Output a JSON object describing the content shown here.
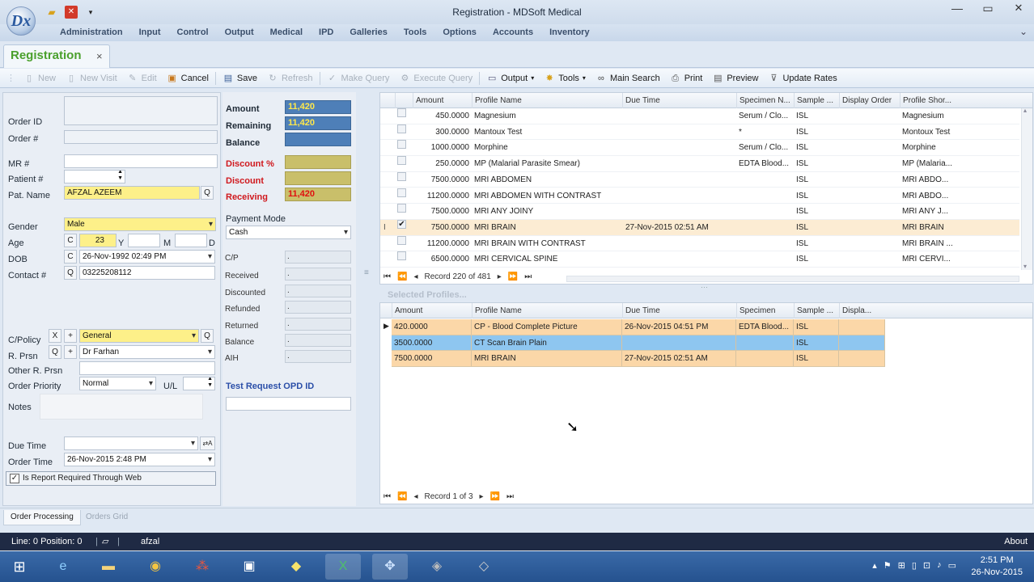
{
  "app": {
    "logo_text": "Dx",
    "title": "Registration - MDSoft Medical",
    "quick_access": [
      "folder-icon",
      "close-red-icon",
      "dropdown-icon"
    ]
  },
  "menu": [
    "Administration",
    "Input",
    "Control",
    "Output",
    "Medical",
    "IPD",
    "Galleries",
    "Tools",
    "Options",
    "Accounts",
    "Inventory"
  ],
  "tab": {
    "label": "Registration",
    "close": "×"
  },
  "toolbar": [
    {
      "label": "New",
      "icon": "new-icon",
      "enabled": false
    },
    {
      "label": "New Visit",
      "icon": "new-visit-icon",
      "enabled": false
    },
    {
      "label": "Edit",
      "icon": "edit-icon",
      "enabled": false
    },
    {
      "label": "Cancel",
      "icon": "cancel-icon",
      "enabled": true
    },
    {
      "label": "Save",
      "icon": "save-icon",
      "enabled": true
    },
    {
      "label": "Refresh",
      "icon": "refresh-icon",
      "enabled": false
    },
    {
      "label": "Make Query",
      "icon": "make-query-icon",
      "enabled": false
    },
    {
      "label": "Execute Query",
      "icon": "execute-query-icon",
      "enabled": false
    },
    {
      "label": "Output",
      "icon": "output-icon",
      "enabled": true,
      "dropdown": true
    },
    {
      "label": "Tools",
      "icon": "tools-icon",
      "enabled": true,
      "dropdown": true
    },
    {
      "label": "Main Search",
      "icon": "binoculars-icon",
      "enabled": true
    },
    {
      "label": "Print",
      "icon": "print-icon",
      "enabled": true
    },
    {
      "label": "Preview",
      "icon": "preview-icon",
      "enabled": true
    },
    {
      "label": "Update Rates",
      "icon": "update-rates-icon",
      "enabled": true
    }
  ],
  "form": {
    "order_id_label": "Order ID",
    "order_no_label": "Order #",
    "mr_label": "MR #",
    "patient_no_label": "Patient #",
    "pat_name_label": "Pat. Name",
    "pat_name": "AFZAL AZEEM",
    "q": "Q",
    "gender_label": "Gender",
    "gender": "Male",
    "age_label": "Age",
    "c": "C",
    "age": "23",
    "y": "Y",
    "m": "M",
    "d": "D",
    "dob_label": "DOB",
    "dob": "26-Nov-1992 02:49 PM",
    "contact_label": "Contact #",
    "contact": "03225208112",
    "cpolicy_label": "C/Policy",
    "x": "X",
    "plus": "+",
    "cpolicy": "General",
    "rprsn_label": "R. Prsn",
    "rprsn": "Dr Farhan",
    "other_rprsn_label": "Other R. Prsn",
    "order_priority_label": "Order Priority",
    "order_priority": "Normal",
    "ul_label": "U/L",
    "notes_label": "Notes",
    "due_time_label": "Due Time",
    "due_btn": "⇄A",
    "order_time_label": "Order Time",
    "order_time": "26-Nov-2015 2:48 PM",
    "report_web_label": "Is Report Required Through Web",
    "report_web_checked": "✓"
  },
  "billing": {
    "amount_label": "Amount",
    "amount": "11,420",
    "remaining_label": "Remaining",
    "remaining": "11,420",
    "balance_label": "Balance",
    "discount_pct_label": "Discount %",
    "discount_label": "Discount",
    "receiving_label": "Receiving",
    "receiving": "11,420",
    "payment_mode_label": "Payment Mode",
    "payment_mode": "Cash",
    "summary": [
      {
        "label": "C/P",
        "value": "."
      },
      {
        "label": "Received",
        "value": "."
      },
      {
        "label": "Discounted",
        "value": "."
      },
      {
        "label": "Refunded",
        "value": "."
      },
      {
        "label": "Returned",
        "value": "."
      },
      {
        "label": "Balance",
        "value": "."
      },
      {
        "label": "AIH",
        "value": "."
      }
    ],
    "test_request_label": "Test Request OPD ID"
  },
  "profiles_grid": {
    "headers": [
      "Amount",
      "Profile Name",
      "Due Time",
      "Specimen N...",
      "Sample ...",
      "Display Order",
      "Profile Shor..."
    ],
    "rows": [
      {
        "checked": false,
        "amount": "450.0000",
        "name": "Magnesium",
        "due": "",
        "specimen": "Serum / Clo...",
        "sample": "ISL",
        "order": "",
        "short": "Magnesium"
      },
      {
        "checked": false,
        "amount": "300.0000",
        "name": "Mantoux Test",
        "due": "",
        "specimen": "*",
        "sample": "ISL",
        "order": "",
        "short": "Montoux Test"
      },
      {
        "checked": false,
        "amount": "1000.0000",
        "name": "Morphine",
        "due": "",
        "specimen": "Serum / Clo...",
        "sample": "ISL",
        "order": "",
        "short": "Morphine"
      },
      {
        "checked": false,
        "amount": "250.0000",
        "name": "MP (Malarial Parasite Smear)",
        "due": "",
        "specimen": "EDTA Blood...",
        "sample": "ISL",
        "order": "",
        "short": "MP (Malaria..."
      },
      {
        "checked": false,
        "amount": "7500.0000",
        "name": "MRI ABDOMEN",
        "due": "",
        "specimen": "",
        "sample": "ISL",
        "order": "",
        "short": "MRI ABDO..."
      },
      {
        "checked": false,
        "amount": "11200.0000",
        "name": "MRI ABDOMEN WITH CONTRAST",
        "due": "",
        "specimen": "",
        "sample": "ISL",
        "order": "",
        "short": "MRI ABDO..."
      },
      {
        "checked": false,
        "amount": "7500.0000",
        "name": "MRI ANY JOINY",
        "due": "",
        "specimen": "",
        "sample": "ISL",
        "order": "",
        "short": "MRI ANY J..."
      },
      {
        "checked": true,
        "amount": "7500.0000",
        "name": "MRI BRAIN",
        "due": "27-Nov-2015 02:51 AM",
        "specimen": "",
        "sample": "ISL",
        "order": "",
        "short": "MRI BRAIN"
      },
      {
        "checked": false,
        "amount": "11200.0000",
        "name": "MRI BRAIN WITH CONTRAST",
        "due": "",
        "specimen": "",
        "sample": "ISL",
        "order": "",
        "short": "MRI BRAIN ..."
      },
      {
        "checked": false,
        "amount": "6500.0000",
        "name": "MRI CERVICAL SPINE",
        "due": "",
        "specimen": "",
        "sample": "ISL",
        "order": "",
        "short": "MRI CERVI..."
      }
    ],
    "record_text": "Record 220 of 481",
    "row_indicator": "I"
  },
  "selected_grid": {
    "title": "Selected Profiles...",
    "headers": [
      "Amount",
      "Profile Name",
      "Due Time",
      "Specimen",
      "Sample ...",
      "Displa..."
    ],
    "rows": [
      {
        "amount": "420.0000",
        "name": "CP - Blood Complete Picture",
        "due": "26-Nov-2015 04:51 PM",
        "specimen": "EDTA Blood...",
        "sample": "ISL",
        "display": ""
      },
      {
        "amount": "3500.0000",
        "name": "CT Scan Brain Plain",
        "due": "",
        "specimen": "",
        "sample": "ISL",
        "display": ""
      },
      {
        "amount": "7500.0000",
        "name": "MRI BRAIN",
        "due": "27-Nov-2015 02:51 AM",
        "specimen": "",
        "sample": "ISL",
        "display": ""
      }
    ],
    "record_text": "Record 1 of 3"
  },
  "bottom_tabs": [
    "Order Processing",
    "Orders Grid"
  ],
  "status": {
    "line": "Line: 0  Position: 0",
    "user": "afzal",
    "about": "About"
  },
  "taskbar": {
    "apps": [
      "windows-start-icon",
      "internet-explorer-icon",
      "file-explorer-icon",
      "chrome-icon",
      "apps-icon",
      "folder-window-icon",
      "sticky-notes-icon",
      "excel-icon",
      "mdsoft-icon",
      "game-icon",
      "terminal-icon"
    ],
    "time": "2:51 PM",
    "date": "26-Nov-2015"
  }
}
